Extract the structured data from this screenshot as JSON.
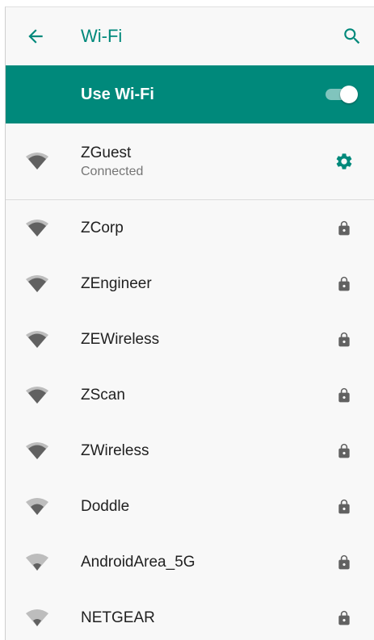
{
  "appbar": {
    "title": "Wi-Fi",
    "back_icon": "arrow-back-icon",
    "search_icon": "search-icon"
  },
  "master_switch": {
    "label": "Use Wi-Fi",
    "checked": true
  },
  "colors": {
    "accent": "#00897b",
    "icon_gray": "#616161",
    "icon_light": "#bdbdbd"
  },
  "connected_network": {
    "name": "ZGuest",
    "status": "Connected",
    "signal_level": 3,
    "action_icon": "gear-icon"
  },
  "networks": [
    {
      "name": "ZCorp",
      "signal_level": 3,
      "secured": true
    },
    {
      "name": "ZEngineer",
      "signal_level": 3,
      "secured": true
    },
    {
      "name": "ZEWireless",
      "signal_level": 3,
      "secured": true
    },
    {
      "name": "ZScan",
      "signal_level": 3,
      "secured": true
    },
    {
      "name": "ZWireless",
      "signal_level": 3,
      "secured": true
    },
    {
      "name": "Doddle",
      "signal_level": 2,
      "secured": true
    },
    {
      "name": "AndroidArea_5G",
      "signal_level": 1,
      "secured": true
    },
    {
      "name": "NETGEAR",
      "signal_level": 1,
      "secured": true
    }
  ]
}
